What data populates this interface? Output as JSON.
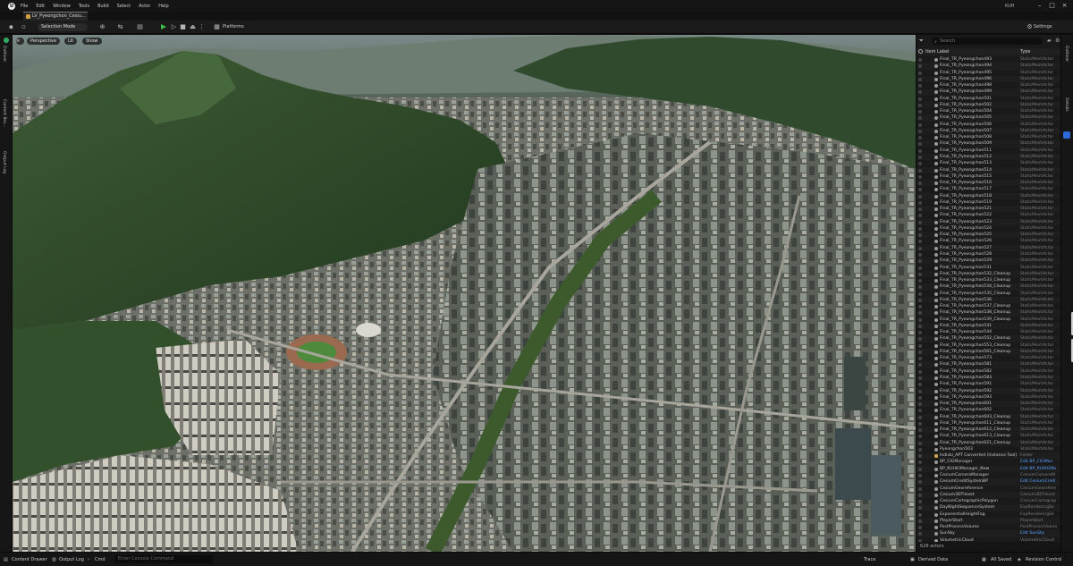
{
  "menu": {
    "items": [
      "File",
      "Edit",
      "Window",
      "Tools",
      "Build",
      "Select",
      "Actor",
      "Help"
    ],
    "project": "KUH"
  },
  "tab": {
    "label": "LV_Pyeongchon_Cesiu..."
  },
  "toolbar": {
    "selection_mode": "Selection Mode",
    "platforms": "Platforms",
    "settings": "Settings"
  },
  "viewport": {
    "perspective": "Perspective",
    "lit": "Lit",
    "show": "Show"
  },
  "left_tabs": [
    "Outliner",
    "Content Bro...",
    "Output Log"
  ],
  "right_tabs": [
    "Outliner",
    "Details"
  ],
  "outliner": {
    "search_placeholder": "Search",
    "col_label": "Item Label",
    "col_type": "Type",
    "rows": [
      {
        "label": "Final_TR_Pyeongchon493",
        "type": "StaticMeshActor"
      },
      {
        "label": "Final_TR_Pyeongchon494",
        "type": "StaticMeshActor"
      },
      {
        "label": "Final_TR_Pyeongchon495",
        "type": "StaticMeshActor"
      },
      {
        "label": "Final_TR_Pyeongchon496",
        "type": "StaticMeshActor"
      },
      {
        "label": "Final_TR_Pyeongchon498",
        "type": "StaticMeshActor"
      },
      {
        "label": "Final_TR_Pyeongchon499",
        "type": "StaticMeshActor"
      },
      {
        "label": "Final_TR_Pyeongchon501",
        "type": "StaticMeshActor"
      },
      {
        "label": "Final_TR_Pyeongchon502",
        "type": "StaticMeshActor"
      },
      {
        "label": "Final_TR_Pyeongchon504",
        "type": "StaticMeshActor"
      },
      {
        "label": "Final_TR_Pyeongchon505",
        "type": "StaticMeshActor"
      },
      {
        "label": "Final_TR_Pyeongchon506",
        "type": "StaticMeshActor"
      },
      {
        "label": "Final_TR_Pyeongchon507",
        "type": "StaticMeshActor"
      },
      {
        "label": "Final_TR_Pyeongchon508",
        "type": "StaticMeshActor"
      },
      {
        "label": "Final_TR_Pyeongchon509",
        "type": "StaticMeshActor"
      },
      {
        "label": "Final_TR_Pyeongchon511",
        "type": "StaticMeshActor"
      },
      {
        "label": "Final_TR_Pyeongchon512",
        "type": "StaticMeshActor"
      },
      {
        "label": "Final_TR_Pyeongchon513",
        "type": "StaticMeshActor"
      },
      {
        "label": "Final_TR_Pyeongchon514",
        "type": "StaticMeshActor"
      },
      {
        "label": "Final_TR_Pyeongchon515",
        "type": "StaticMeshActor"
      },
      {
        "label": "Final_TR_Pyeongchon516",
        "type": "StaticMeshActor"
      },
      {
        "label": "Final_TR_Pyeongchon517",
        "type": "StaticMeshActor"
      },
      {
        "label": "Final_TR_Pyeongchon518",
        "type": "StaticMeshActor"
      },
      {
        "label": "Final_TR_Pyeongchon519",
        "type": "StaticMeshActor"
      },
      {
        "label": "Final_TR_Pyeongchon521",
        "type": "StaticMeshActor"
      },
      {
        "label": "Final_TR_Pyeongchon522",
        "type": "StaticMeshActor"
      },
      {
        "label": "Final_TR_Pyeongchon523",
        "type": "StaticMeshActor"
      },
      {
        "label": "Final_TR_Pyeongchon524",
        "type": "StaticMeshActor"
      },
      {
        "label": "Final_TR_Pyeongchon525",
        "type": "StaticMeshActor"
      },
      {
        "label": "Final_TR_Pyeongchon526",
        "type": "StaticMeshActor"
      },
      {
        "label": "Final_TR_Pyeongchon527",
        "type": "StaticMeshActor"
      },
      {
        "label": "Final_TR_Pyeongchon528",
        "type": "StaticMeshActor"
      },
      {
        "label": "Final_TR_Pyeongchon529",
        "type": "StaticMeshActor"
      },
      {
        "label": "Final_TR_Pyeongchon531",
        "type": "StaticMeshActor"
      },
      {
        "label": "Final_TR_Pyeongchon532_Cleanup",
        "type": "StaticMeshActor"
      },
      {
        "label": "Final_TR_Pyeongchon533_Cleanup",
        "type": "StaticMeshActor"
      },
      {
        "label": "Final_TR_Pyeongchon534_Cleanup",
        "type": "StaticMeshActor"
      },
      {
        "label": "Final_TR_Pyeongchon535_Cleanup",
        "type": "StaticMeshActor"
      },
      {
        "label": "Final_TR_Pyeongchon536",
        "type": "StaticMeshActor"
      },
      {
        "label": "Final_TR_Pyeongchon537_Cleanup",
        "type": "StaticMeshActor"
      },
      {
        "label": "Final_TR_Pyeongchon538_Cleanup",
        "type": "StaticMeshActor"
      },
      {
        "label": "Final_TR_Pyeongchon539_Cleanup",
        "type": "StaticMeshActor"
      },
      {
        "label": "Final_TR_Pyeongchon541",
        "type": "StaticMeshActor"
      },
      {
        "label": "Final_TR_Pyeongchon544",
        "type": "StaticMeshActor"
      },
      {
        "label": "Final_TR_Pyeongchon552_Cleanup",
        "type": "StaticMeshActor"
      },
      {
        "label": "Final_TR_Pyeongchon553_Cleanup",
        "type": "StaticMeshActor"
      },
      {
        "label": "Final_TR_Pyeongchon561_Cleanup",
        "type": "StaticMeshActor"
      },
      {
        "label": "Final_TR_Pyeongchon573",
        "type": "StaticMeshActor"
      },
      {
        "label": "Final_TR_Pyeongchon581",
        "type": "StaticMeshActor"
      },
      {
        "label": "Final_TR_Pyeongchon582",
        "type": "StaticMeshActor"
      },
      {
        "label": "Final_TR_Pyeongchon583",
        "type": "StaticMeshActor"
      },
      {
        "label": "Final_TR_Pyeongchon591",
        "type": "StaticMeshActor"
      },
      {
        "label": "Final_TR_Pyeongchon592",
        "type": "StaticMeshActor"
      },
      {
        "label": "Final_TR_Pyeongchon593",
        "type": "StaticMeshActor"
      },
      {
        "label": "Final_TR_Pyeongchon601",
        "type": "StaticMeshActor"
      },
      {
        "label": "Final_TR_Pyeongchon602",
        "type": "StaticMeshActor"
      },
      {
        "label": "Final_TR_Pyeongchon603_Cleanup",
        "type": "StaticMeshActor"
      },
      {
        "label": "Final_TR_Pyeongchon611_Cleanup",
        "type": "StaticMeshActor"
      },
      {
        "label": "Final_TR_Pyeongchon612_Cleanup",
        "type": "StaticMeshActor"
      },
      {
        "label": "Final_TR_Pyeongchon613_Cleanup",
        "type": "StaticMeshActor"
      },
      {
        "label": "Final_TR_Pyeongchon621_Cleanup",
        "type": "StaticMeshActor"
      },
      {
        "label": "Pyeongchon503",
        "type": "StaticMeshActor"
      },
      {
        "label": "Indiski_APT Converted (Instance Tool)",
        "type": "Folder",
        "folder": true
      },
      {
        "label": "BP_CIGManager",
        "type": "Edit BP_CIGMan",
        "link": true
      },
      {
        "label": "BP_KUHIGManager_New",
        "type": "Edit BP_KUHIGMa",
        "link": true
      },
      {
        "label": "CesiumCameraManager",
        "type": "CesiumCameraM"
      },
      {
        "label": "CesiumCreditSystemBP",
        "type": "Edit CesiumCredi",
        "link": true
      },
      {
        "label": "CesiumGeoreference",
        "type": "CesiumGeorefere"
      },
      {
        "label": "Cesium3DTileset",
        "type": "Cesium3DTileset"
      },
      {
        "label": "CesiumCartographicPolygon",
        "type": "CesiumCartograp"
      },
      {
        "label": "DayNightSequenceSystem",
        "type": "ExpRenderingSe"
      },
      {
        "label": "ExponentialHeightFog",
        "type": "ExpRenderingSe"
      },
      {
        "label": "PlayerStart",
        "type": "PlayerStart"
      },
      {
        "label": "PostProcessVolume",
        "type": "PostProcessVolum"
      },
      {
        "label": "SunSky",
        "type": "Edit SunSky",
        "link": true
      },
      {
        "label": "VolumetricCloud",
        "type": "VolumetricCloud"
      }
    ],
    "footer": "628 actors"
  },
  "statusbar": {
    "content_drawer": "Content Drawer",
    "output_log": "Output Log",
    "cmd": "Cmd",
    "cmd_placeholder": "Enter Console Command",
    "trace": "Trace",
    "derived_data": "Derived Data",
    "all_saved": "All Saved",
    "revision_control": "Revision Control"
  }
}
